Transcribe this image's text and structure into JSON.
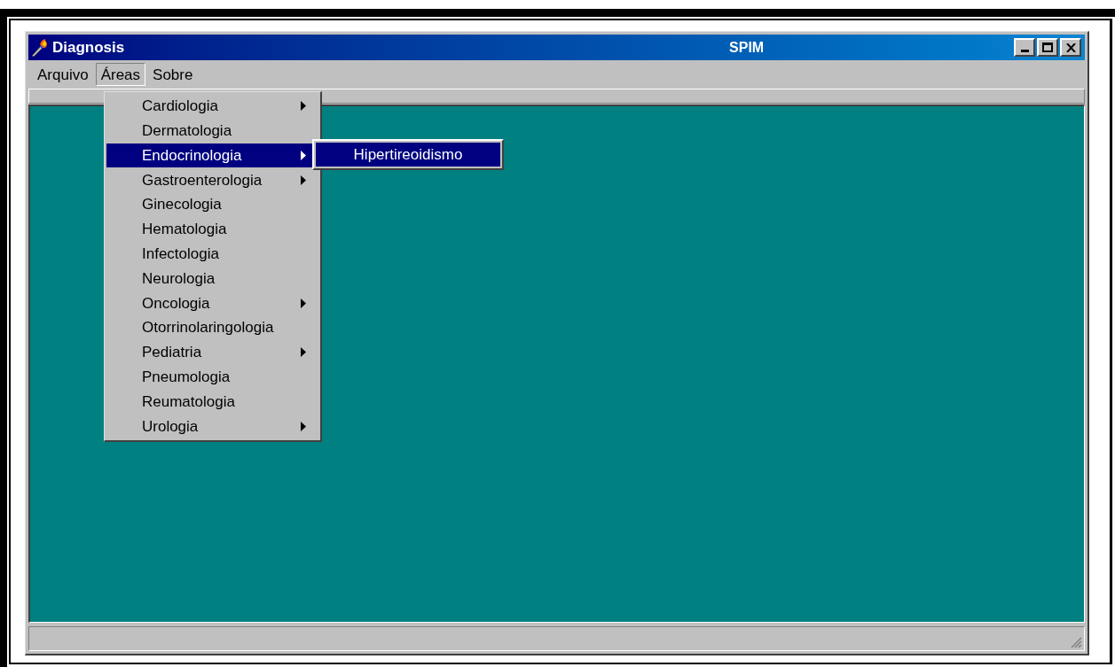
{
  "window": {
    "title": "Diagnosis",
    "caption": "SPIM"
  },
  "menu_bar": [
    {
      "label": "Arquivo",
      "selected": false
    },
    {
      "label": "Áreas",
      "selected": true
    },
    {
      "label": "Sobre",
      "selected": false
    }
  ],
  "areas_menu": [
    {
      "label": "Cardiologia",
      "submenu": true,
      "selected": false
    },
    {
      "label": "Dermatologia",
      "submenu": false,
      "selected": false
    },
    {
      "label": "Endocrinologia",
      "submenu": true,
      "selected": true
    },
    {
      "label": "Gastroenterologia",
      "submenu": true,
      "selected": false
    },
    {
      "label": "Ginecologia",
      "submenu": false,
      "selected": false
    },
    {
      "label": "Hematologia",
      "submenu": false,
      "selected": false
    },
    {
      "label": "Infectologia",
      "submenu": false,
      "selected": false
    },
    {
      "label": "Neurologia",
      "submenu": false,
      "selected": false
    },
    {
      "label": "Oncologia",
      "submenu": true,
      "selected": false
    },
    {
      "label": "Otorrinolaringologia",
      "submenu": false,
      "selected": false
    },
    {
      "label": "Pediatria",
      "submenu": true,
      "selected": false
    },
    {
      "label": "Pneumologia",
      "submenu": false,
      "selected": false
    },
    {
      "label": "Reumatologia",
      "submenu": false,
      "selected": false
    },
    {
      "label": "Urologia",
      "submenu": true,
      "selected": false
    }
  ],
  "submenu": [
    {
      "label": "Hipertireoidismo",
      "selected": true
    }
  ]
}
